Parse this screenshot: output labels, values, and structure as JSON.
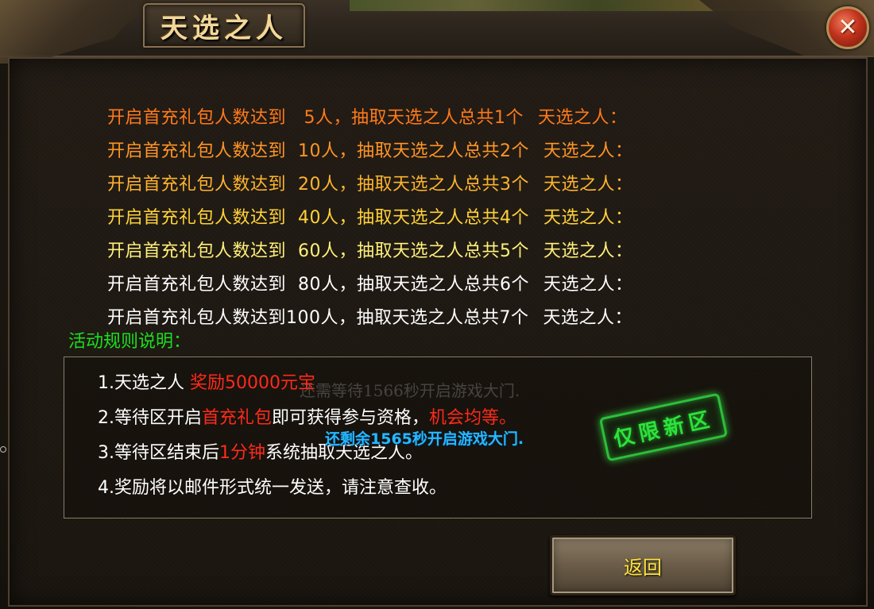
{
  "dialog": {
    "title": "天选之人"
  },
  "tiers": [
    {
      "requirement": "开启首充礼包人数达到   5人，抽取天选之人总共1个",
      "prize_label": "天选之人：",
      "color": "#ff7a1a"
    },
    {
      "requirement": "开启首充礼包人数达到  10人，抽取天选之人总共2个",
      "prize_label": "天选之人：",
      "color": "#ff9526"
    },
    {
      "requirement": "开启首充礼包人数达到  20人，抽取天选之人总共3个",
      "prize_label": "天选之人：",
      "color": "#ffb42e"
    },
    {
      "requirement": "开启首充礼包人数达到  40人，抽取天选之人总共4个",
      "prize_label": "天选之人：",
      "color": "#ffd23a"
    },
    {
      "requirement": "开启首充礼包人数达到  60人，抽取天选之人总共5个",
      "prize_label": "天选之人：",
      "color": "#fff07a"
    },
    {
      "requirement": "开启首充礼包人数达到  80人，抽取天选之人总共6个",
      "prize_label": "天选之人：",
      "color": "#ffffff"
    },
    {
      "requirement": "开启首充礼包人数达到100人，抽取天选之人总共7个",
      "prize_label": "天选之人：",
      "color": "#ffffff"
    }
  ],
  "rules": {
    "title": "活动规则说明：",
    "items": [
      {
        "prefix": "1.天选之人 ",
        "highlight": "奖励50000元宝",
        "suffix": ""
      },
      {
        "prefix": "2.等待区开启",
        "highlight": "首充礼包",
        "suffix": "即可获得参与资格，",
        "highlight2": "机会均等。"
      },
      {
        "prefix": "3.等待区结束后",
        "highlight": "1分钟",
        "suffix": "系统抽取天选之人。"
      },
      {
        "prefix": "4.奖励将以邮件形式统一发送，请注意查收。",
        "highlight": "",
        "suffix": ""
      }
    ],
    "ghost_text": "还需等待1566秒开启游戏大门.",
    "countdown": "还剩余1565秒开启游戏大门."
  },
  "stamp": {
    "text": "仅限新区"
  },
  "buttons": {
    "back": "返回",
    "close": "✕"
  },
  "colors": {
    "rules_title": "#19e01c",
    "highlight": "#ff2a1a",
    "countdown": "#27b8ff",
    "stamp": "#2ee23c",
    "back_label": "#ffe23a"
  }
}
